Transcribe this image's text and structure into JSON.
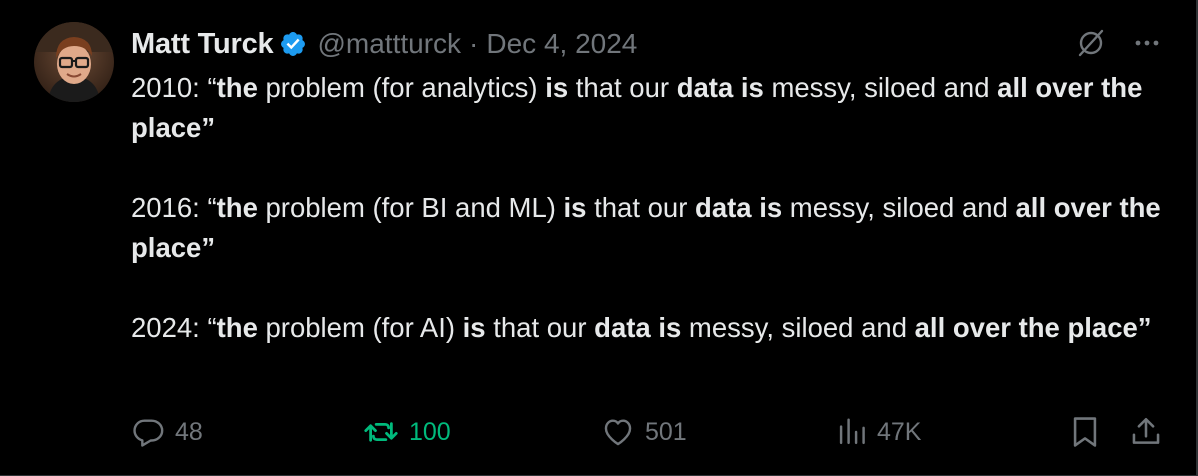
{
  "tweet": {
    "author": {
      "name": "Matt Turck",
      "handle": "@mattturck",
      "verified": true
    },
    "separator": "·",
    "date": "Dec 4, 2024",
    "paragraphs": [
      [
        {
          "text": "2010: “",
          "bold": false
        },
        {
          "text": "the",
          "bold": true
        },
        {
          "text": " problem (for analytics) ",
          "bold": false
        },
        {
          "text": "is",
          "bold": true
        },
        {
          "text": " that our ",
          "bold": false
        },
        {
          "text": "data is",
          "bold": true
        },
        {
          "text": " messy, siloed and ",
          "bold": false
        },
        {
          "text": "all over the place”",
          "bold": true
        }
      ],
      [
        {
          "text": "2016:  “",
          "bold": false
        },
        {
          "text": "the",
          "bold": true
        },
        {
          "text": " problem (for BI and ML) ",
          "bold": false
        },
        {
          "text": "is",
          "bold": true
        },
        {
          "text": " that our ",
          "bold": false
        },
        {
          "text": "data is",
          "bold": true
        },
        {
          "text": " messy, siloed and ",
          "bold": false
        },
        {
          "text": "all over the place”",
          "bold": true
        }
      ],
      [
        {
          "text": "2024:  “",
          "bold": false
        },
        {
          "text": "the",
          "bold": true
        },
        {
          "text": " problem (for AI) ",
          "bold": false
        },
        {
          "text": "is",
          "bold": true
        },
        {
          "text": " that our ",
          "bold": false
        },
        {
          "text": "data is",
          "bold": true
        },
        {
          "text": " messy, siloed and ",
          "bold": false
        },
        {
          "text": "all over the place”",
          "bold": true
        }
      ]
    ],
    "stats": {
      "replies": "48",
      "retweets": "100",
      "likes": "501",
      "views": "47K"
    },
    "icons": {
      "verified": "verified-badge-icon",
      "grok": "grok-icon",
      "more": "more-icon",
      "reply": "reply-icon",
      "retweet": "retweet-icon",
      "like": "heart-icon",
      "views": "views-icon",
      "bookmark": "bookmark-icon",
      "share": "share-icon"
    },
    "colors": {
      "background": "#000000",
      "text": "#e7e9ea",
      "muted": "#71767b",
      "verified": "#1d9bf0",
      "retweeted": "#00ba7c"
    }
  }
}
